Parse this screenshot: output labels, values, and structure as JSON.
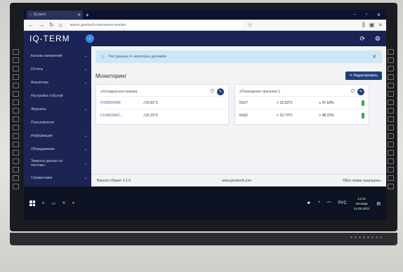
{
  "browser": {
    "tab_title": "IQ-term",
    "url": "iqterm.goodsoft.com/sensor-monitor",
    "window_controls": [
      "–",
      "▫",
      "✕"
    ]
  },
  "app": {
    "logo": "IQ-TERM",
    "collapse": "‹"
  },
  "sidebar": {
    "items": [
      {
        "label": "Каналы измерений"
      },
      {
        "label": "Отчеты"
      },
      {
        "label": "Аналитика"
      },
      {
        "label": "Настройки событий"
      },
      {
        "label": "Журналы"
      },
      {
        "label": "Пользователи"
      },
      {
        "label": "Информация"
      },
      {
        "label": "Оборудование"
      },
      {
        "label": "Запросы данных из системы"
      },
      {
        "label": "Справочники"
      }
    ]
  },
  "alert": {
    "text": "Нет данных от некоторых датчиков",
    "icon": "info-icon"
  },
  "page": {
    "title": "Мониторинг",
    "edit_button": "Редактировать"
  },
  "cards": [
    {
      "title": "Холодильная камера",
      "rows": [
        {
          "id": "F0000000A8",
          "value": "22.81°C"
        },
        {
          "id": "F10000000C...",
          "value": "22.15°C"
        }
      ]
    },
    {
      "title": "Помещение хранения 1",
      "rows": [
        {
          "name": "N107",
          "temp": "22.93°C",
          "hum": "47.59%"
        },
        {
          "name": "N102",
          "temp": "22.73°C",
          "hum": "48.22%"
        }
      ]
    }
  ],
  "footer": {
    "version": "Версия сборки: 4.1.0",
    "site": "www.goodsoft.com",
    "rights": "©Все права защищены"
  },
  "taskbar": {
    "lang": "РУС",
    "time": "13:19",
    "date": "14.05.2021",
    "day": "пятница"
  },
  "colors": {
    "header": "#1a2356",
    "sidebar": "#1b2452",
    "accent": "#3b8de0",
    "battery": "#2eb14a"
  }
}
